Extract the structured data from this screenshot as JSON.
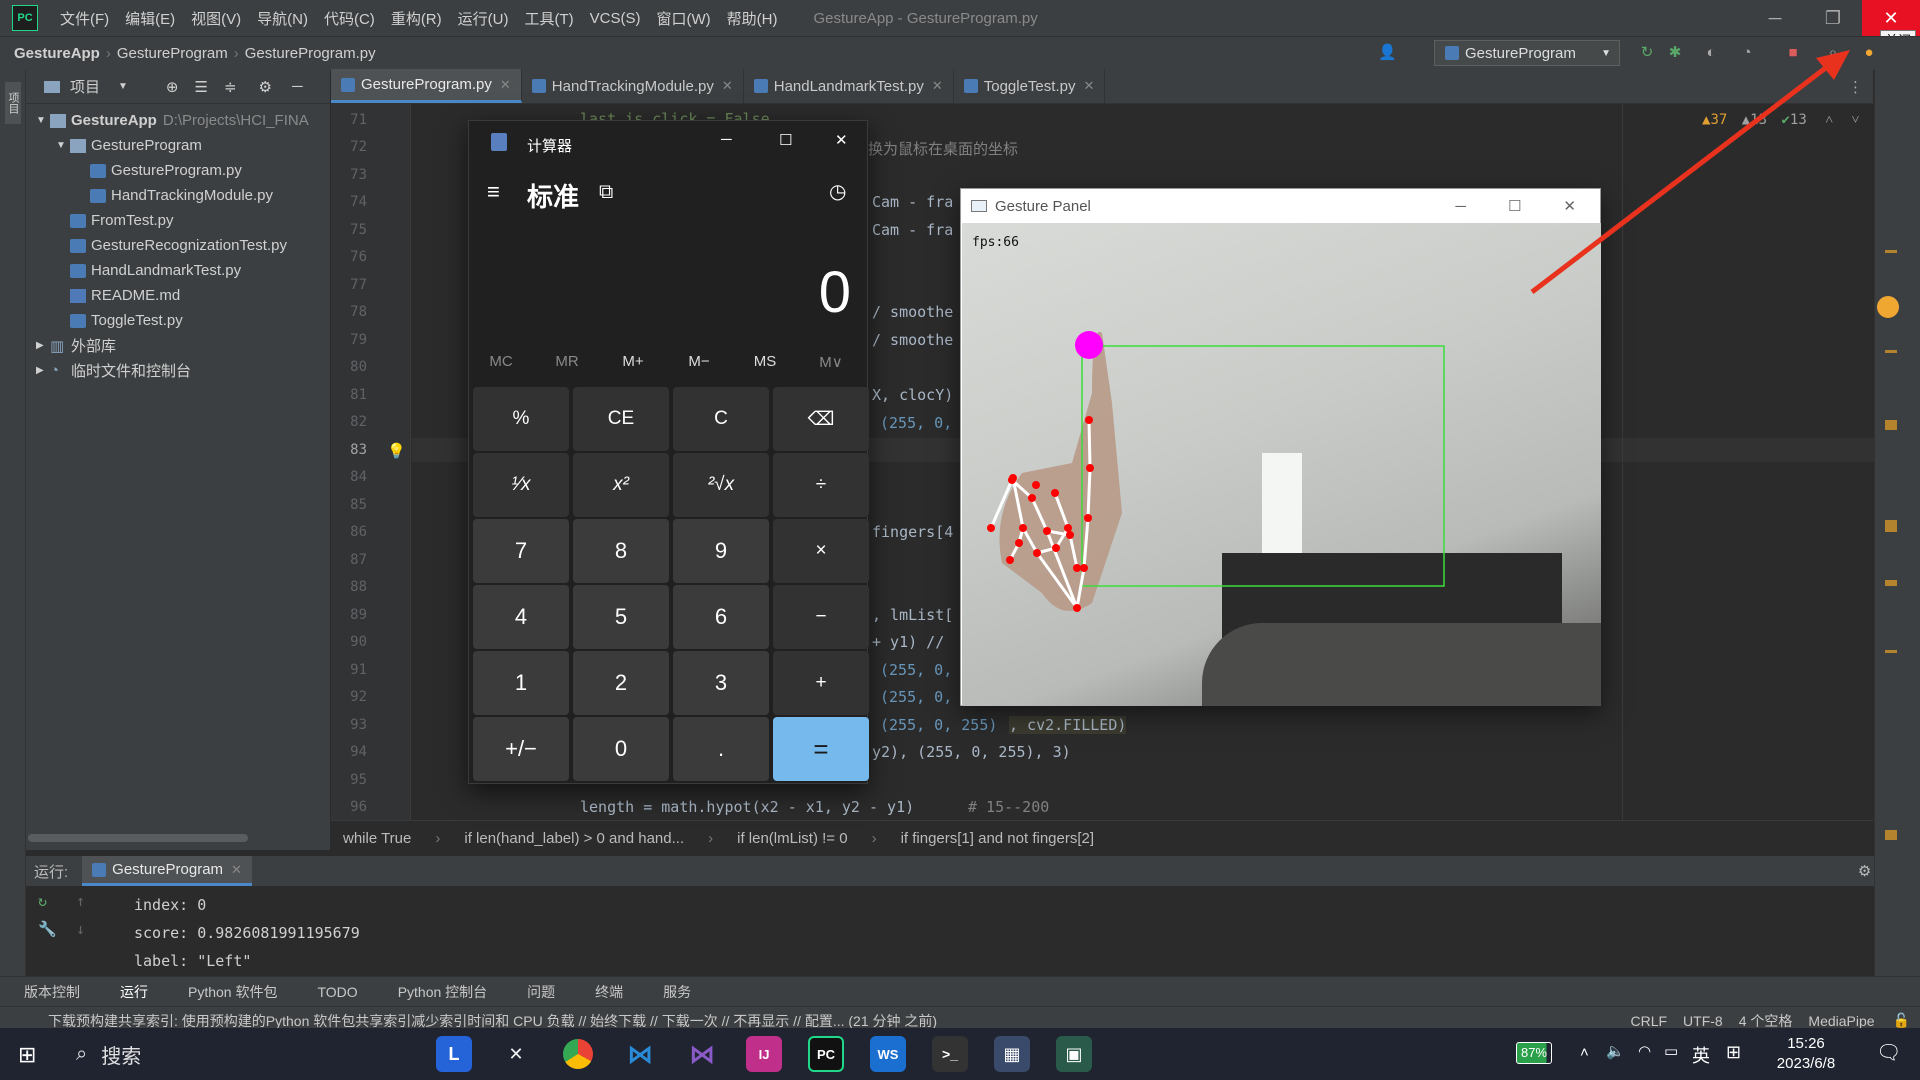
{
  "menubar": {
    "items": [
      "文件(F)",
      "编辑(E)",
      "视图(V)",
      "导航(N)",
      "代码(C)",
      "重构(R)",
      "运行(U)",
      "工具(T)",
      "VCS(S)",
      "窗口(W)",
      "帮助(H)"
    ],
    "window_title": "GestureApp - GestureProgram.py",
    "close_tooltip": "关闭"
  },
  "navbar": {
    "crumbs": [
      "GestureApp",
      "GestureProgram",
      "GestureProgram.py"
    ],
    "run_config": "GestureProgram"
  },
  "project": {
    "header": "项目",
    "root_name": "GestureApp",
    "root_path": "D:\\Projects\\HCI_FINA",
    "items": [
      "GestureProgram",
      "GestureProgram.py",
      "HandTrackingModule.py",
      "FromTest.py",
      "GestureRecognizationTest.py",
      "HandLandmarkTest.py",
      "README.md",
      "ToggleTest.py",
      "外部库",
      "临时文件和控制台"
    ]
  },
  "tabs": [
    "GestureProgram.py",
    "HandTrackingModule.py",
    "HandLandmarkTest.py",
    "ToggleTest.py"
  ],
  "inspections": {
    "warnings": "37",
    "weak": "13",
    "ok": "13"
  },
  "editor": {
    "line_numbers": [
      "71",
      "72",
      "73",
      "74",
      "75",
      "76",
      "77",
      "78",
      "79",
      "80",
      "81",
      "82",
      "83",
      "84",
      "85",
      "86",
      "87",
      "88",
      "89",
      "90",
      "91",
      "92",
      "93",
      "94",
      "95",
      "96"
    ],
    "fragments": {
      "l71": "last_is_click = False",
      "l72": "换为鼠标在桌面的坐标",
      "l74": "Cam - fra",
      "l75": "Cam - fra",
      "l78": "/ smoothe",
      "l79": "/ smoothe",
      "l81": "X, clocY)",
      "l82": "(255, 0,",
      "l86": "fingers[4",
      "l89": ", lmList[",
      "l90": "+ y1) //",
      "l91": "(255, 0,",
      "l92": "(255, 0,",
      "l93a": "(255, 0, 255)",
      "l93b": ", cv2.FILLED)",
      "l94": "y2), (255, 0, 255), 3)",
      "l96": "length = math.hypot(x2 - x1, y2 - y1)",
      "l96c": "# 15--200"
    }
  },
  "breadcrumbs_bottom": [
    "while True",
    "if len(hand_label) > 0 and hand...",
    "if len(lmList) != 0",
    "if fingers[1] and not fingers[2]"
  ],
  "run": {
    "label": "运行:",
    "tab": "GestureProgram",
    "lines": [
      "index: 0",
      "score: 0.9826081991195679",
      "label: \"Left\""
    ]
  },
  "toolwindows": [
    "版本控制",
    "运行",
    "Python 软件包",
    "TODO",
    "Python 控制台",
    "问题",
    "终端",
    "服务"
  ],
  "status": {
    "message": "下载预构建共享索引: 使用预构建的Python 软件包共享索引减少索引时间和 CPU 负载 // 始终下载 // 下载一次 // 不再显示 // 配置... (21 分钟 之前)",
    "right": [
      "CRLF",
      "UTF-8",
      "4 个空格",
      "MediaPipe"
    ]
  },
  "calculator": {
    "title": "计算器",
    "mode": "标准",
    "display": "0",
    "memory": [
      "MC",
      "MR",
      "M+",
      "M−",
      "MS",
      "M∨"
    ],
    "keys": [
      "%",
      "CE",
      "C",
      "⌫",
      "¹⁄x",
      "x²",
      "²√x",
      "÷",
      "7",
      "8",
      "9",
      "×",
      "4",
      "5",
      "6",
      "−",
      "1",
      "2",
      "3",
      "+",
      "+/−",
      "0",
      ".",
      "="
    ]
  },
  "gesture_panel": {
    "title": "Gesture Panel",
    "fps": "fps:66"
  },
  "taskbar": {
    "search": "搜索",
    "battery": "87%",
    "ime": "英",
    "time": "15:26",
    "date": "2023/6/8"
  },
  "colors": {
    "accent": "#4a88c7",
    "calc_equals": "#76b9ed",
    "close_red": "#e81123",
    "landmark_magenta": "#ff00ff",
    "arrow_red": "#e8321e"
  }
}
